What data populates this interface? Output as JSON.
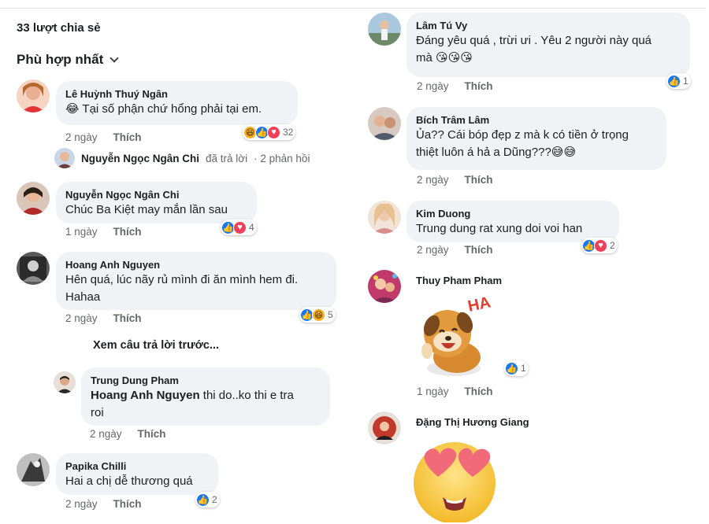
{
  "share_count": "33 lượt chia sẻ",
  "sort": {
    "label": "Phù hợp nhất"
  },
  "left_comments": [
    {
      "name": "Lê Huỳnh Thuý Ngân",
      "text": "😂 Tại số phận chứ hổng phải tại em.",
      "time": "2 ngày",
      "like": "Thích",
      "reactions": "32"
    },
    {
      "name": "Nguyễn Ngọc Ngân Chi",
      "text": "Chúc Ba Kiệt may mắn lần sau",
      "time": "1 ngày",
      "like": "Thích",
      "reactions": "4"
    },
    {
      "name": "Hoang Anh Nguyen",
      "text_line1": "Hên quá, lúc nãy rủ mình đi ăn mình hem đi.",
      "text_line2": "Hahaa",
      "time": "2 ngày",
      "like": "Thích",
      "reactions": "5"
    },
    {
      "name": "Trung Dung Pham",
      "mention": "Hoang Anh Nguyen",
      "text_rest": " thi do..ko thi e tra",
      "text_line2": "roi",
      "time": "2 ngày",
      "like": "Thích"
    },
    {
      "name": "Papika Chilli",
      "text": "Hai a chị dễ thương quá",
      "time": "2 ngày",
      "like": "Thích",
      "reactions": "2"
    }
  ],
  "reply_summary": {
    "name": "Nguyễn Ngọc Ngân Chi",
    "action": "đã trả lời",
    "count": "· 2 phản hồi"
  },
  "more_replies": "Xem câu trả lời trước...",
  "right_comments": [
    {
      "name": "Lâm Tú Vy",
      "text_line1": "Đáng yêu quá , trừi ưi . Yêu 2 người này quá",
      "text_line2": "mà 😘😘😘",
      "time": "2 ngày",
      "like": "Thích",
      "reactions": "1"
    },
    {
      "name": "Bích Trâm Lâm",
      "text_line1": "Ủa?? Cái bóp đẹp z mà k có tiền ở trọng",
      "text_line2": "thiệt luôn á hả a Dũng???😅😅",
      "time": "2 ngày",
      "like": "Thích"
    },
    {
      "name": "Kim Duong",
      "text": "Trung dung rat xung doi voi han",
      "time": "2 ngày",
      "like": "Thích",
      "reactions": "2"
    },
    {
      "name": "Thuy Pham Pham",
      "sticker_text": "HA",
      "time": "1 ngày",
      "like": "Thích",
      "reactions": "1"
    },
    {
      "name": "Đặng Thị Hương Giang"
    }
  ],
  "colors": {
    "like": "#1877f2",
    "love": "#f33e58",
    "haha": "#f7b125",
    "bubble": "#f0f2f5",
    "meta": "#65676b"
  }
}
